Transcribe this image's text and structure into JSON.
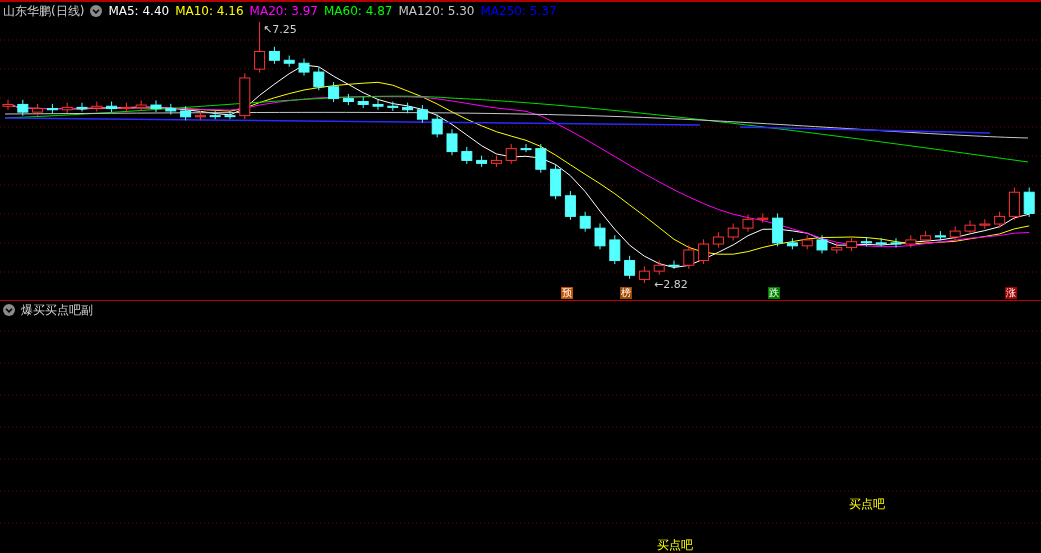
{
  "main_panel": {
    "title": "山东华鹏(日线)",
    "moving_averages": [
      {
        "label": "MA5: 4.40",
        "color": "#ffffff"
      },
      {
        "label": "MA10: 4.16",
        "color": "#ffff00"
      },
      {
        "label": "MA20: 3.97",
        "color": "#ff00ff"
      },
      {
        "label": "MA60: 4.87",
        "color": "#00ff00"
      },
      {
        "label": "MA120: 5.30",
        "color": "#c8c8c8"
      },
      {
        "label": "MA250: 5.37",
        "color": "#0000ff"
      }
    ],
    "high_label": "↖7.25",
    "low_label": "←2.82",
    "markers": [
      {
        "text": "预",
        "color": "#c05000"
      },
      {
        "text": "榜",
        "color": "#a04800"
      },
      {
        "text": "跌",
        "color": "#008000"
      },
      {
        "text": "涨",
        "color": "#a00000"
      }
    ]
  },
  "sub_panel": {
    "title": "爆买买点吧副",
    "signals": [
      {
        "text": "买点吧"
      },
      {
        "text": "买点吧"
      }
    ]
  }
}
